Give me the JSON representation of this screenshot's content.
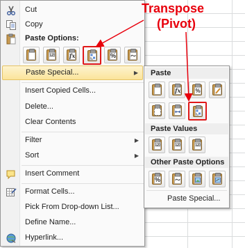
{
  "menu": {
    "cut": "Cut",
    "copy": "Copy",
    "paste_options": "Paste Options:",
    "paste_buttons": [
      "",
      "123",
      "fx",
      "",
      "%",
      ""
    ],
    "paste_special": "Paste Special...",
    "insert_copied": "Insert Copied Cells...",
    "delete": "Delete...",
    "clear_contents": "Clear Contents",
    "filter": "Filter",
    "sort": "Sort",
    "insert_comment": "Insert Comment",
    "format_cells": "Format Cells...",
    "pick_list": "Pick From Drop-down List...",
    "define_name": "Define Name...",
    "hyperlink": "Hyperlink..."
  },
  "submenu": {
    "paste_title": "Paste",
    "paste_values_title": "Paste Values",
    "other_title": "Other Paste Options",
    "paste_special": "Paste Special...",
    "value_buttons": [
      "123",
      "123",
      "123"
    ]
  },
  "annotation": {
    "line1": "Transpose",
    "line2": "(Pivot)",
    "color": "#e8000c"
  }
}
